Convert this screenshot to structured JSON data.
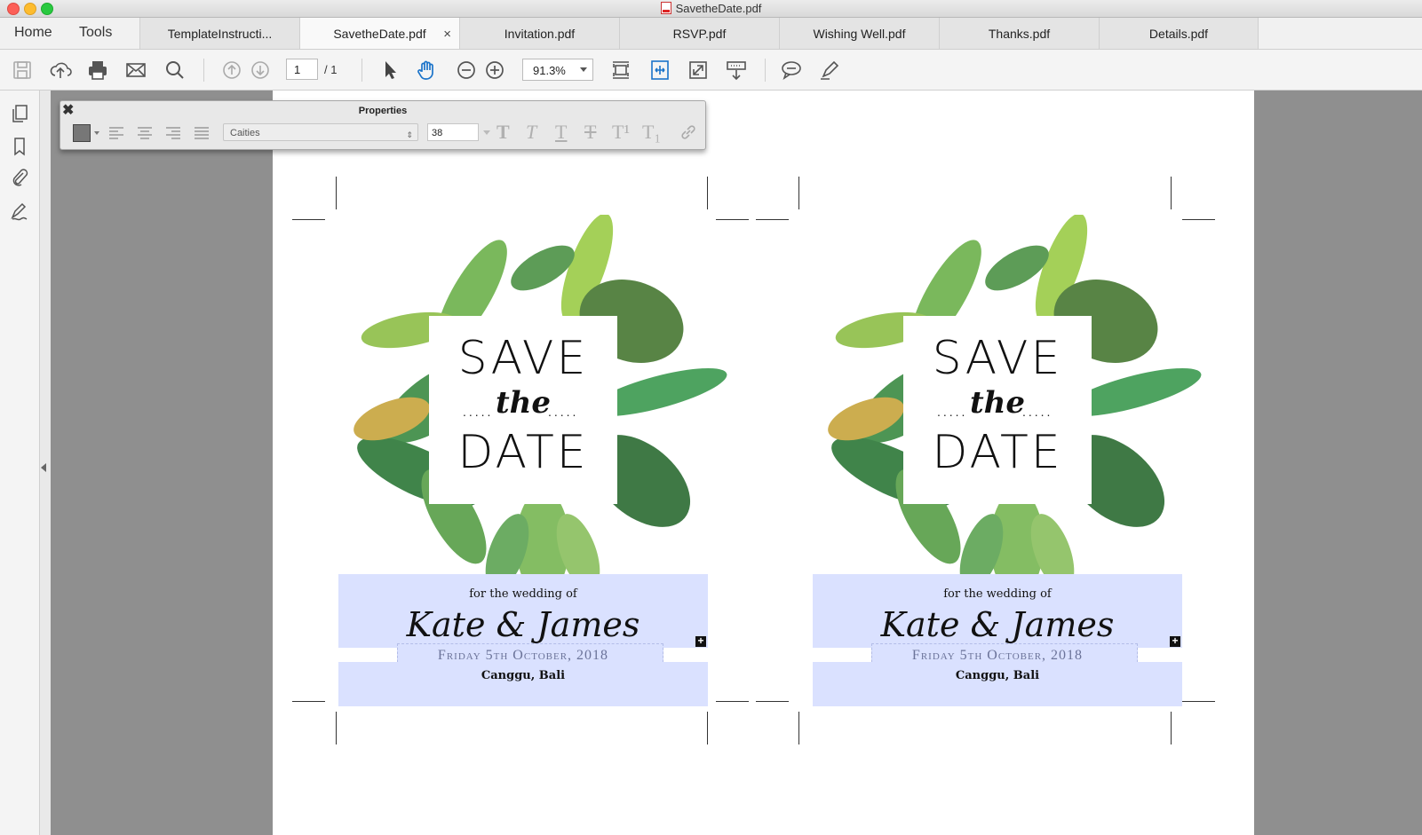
{
  "window": {
    "title": "SavetheDate.pdf"
  },
  "nav": {
    "home": "Home",
    "tools": "Tools"
  },
  "tabs": [
    {
      "label": "TemplateInstructi..."
    },
    {
      "label": "SavetheDate.pdf",
      "close": "×"
    },
    {
      "label": "Invitation.pdf"
    },
    {
      "label": "RSVP.pdf"
    },
    {
      "label": "Wishing Well.pdf"
    },
    {
      "label": "Thanks.pdf"
    },
    {
      "label": "Details.pdf"
    }
  ],
  "toolbar": {
    "page_current": "1",
    "page_total": "/ 1",
    "zoom": "91.3%",
    "icons": [
      "save-icon",
      "cloud-upload-icon",
      "print-icon",
      "mail-icon",
      "search-icon",
      "page-up-icon",
      "page-down-icon",
      "select-arrow-icon",
      "hand-icon",
      "zoom-out-icon",
      "zoom-in-icon",
      "fit-page-icon",
      "fit-width-icon",
      "full-screen-icon",
      "scroll-mode-icon",
      "comment-icon",
      "highlight-pen-icon"
    ]
  },
  "properties": {
    "title": "Properties",
    "close": "✖",
    "font": "Caities",
    "font_size": "38",
    "text_styles": [
      "T",
      "T",
      "T",
      "T",
      "T¹",
      "T₁"
    ]
  },
  "cards": [
    {
      "save": "SAVE",
      "the": "the",
      "date": "DATE",
      "dots": ".....",
      "for_wedding": "for the wedding of",
      "names": "Kate & James",
      "date_line": "Friday 5th October, 2018",
      "place": "Canggu, Bali",
      "plus": "+"
    },
    {
      "save": "SAVE",
      "the": "the",
      "date": "DATE",
      "dots": ".....",
      "for_wedding": "for the wedding of",
      "names": "Kate & James",
      "date_line": "Friday 5th October, 2018",
      "place": "Canggu, Bali",
      "plus": "+"
    }
  ],
  "colors": {
    "form_field_highlight": "#dae1ff",
    "canvas_gray": "#8f8f8f",
    "accent_blue": "#1a73c9"
  }
}
